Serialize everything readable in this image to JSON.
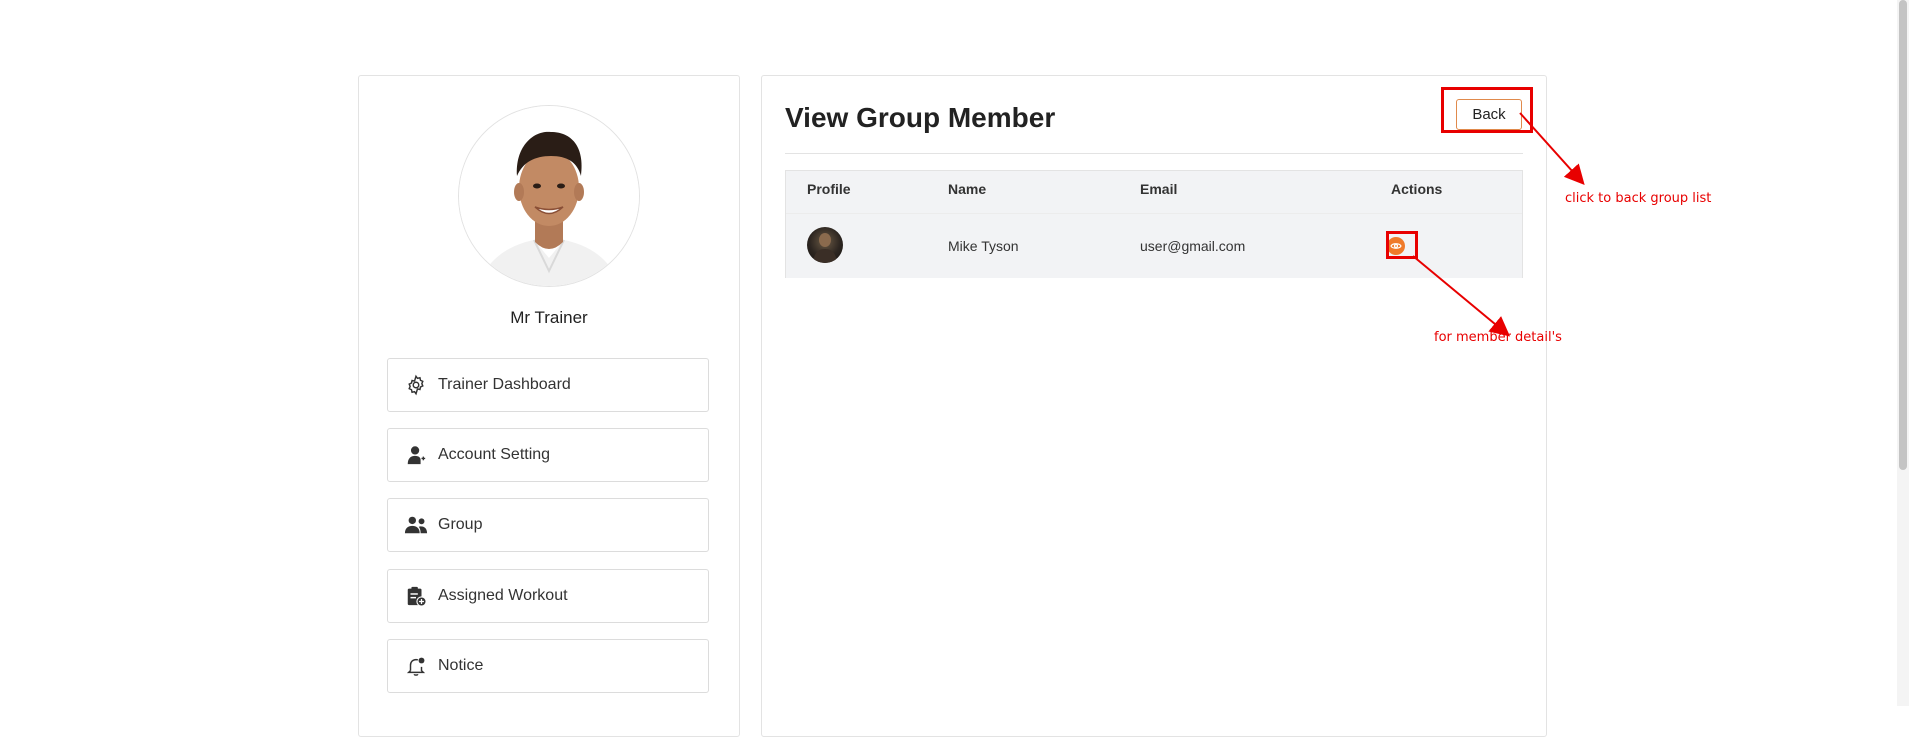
{
  "sidebar": {
    "trainer_name": "Mr Trainer",
    "items": [
      {
        "label": "Trainer Dashboard",
        "icon": "gear-icon"
      },
      {
        "label": "Account Setting",
        "icon": "user-icon"
      },
      {
        "label": "Group",
        "icon": "users-icon"
      },
      {
        "label": "Assigned Workout",
        "icon": "clipboard-icon"
      },
      {
        "label": "Notice",
        "icon": "bell-icon"
      }
    ]
  },
  "main": {
    "title": "View Group Member",
    "back_label": "Back",
    "table": {
      "headers": [
        "Profile",
        "Name",
        "Email",
        "Actions"
      ],
      "rows": [
        {
          "name": "Mike Tyson",
          "email": "user@gmail.com",
          "action_icon": "eye-icon"
        }
      ]
    }
  },
  "annotations": {
    "back_note": "click to back group list",
    "view_note": "for member detail's"
  },
  "colors": {
    "accent": "#ef7a2a",
    "annotation": "#e80000",
    "border": "#e3e3e3"
  }
}
